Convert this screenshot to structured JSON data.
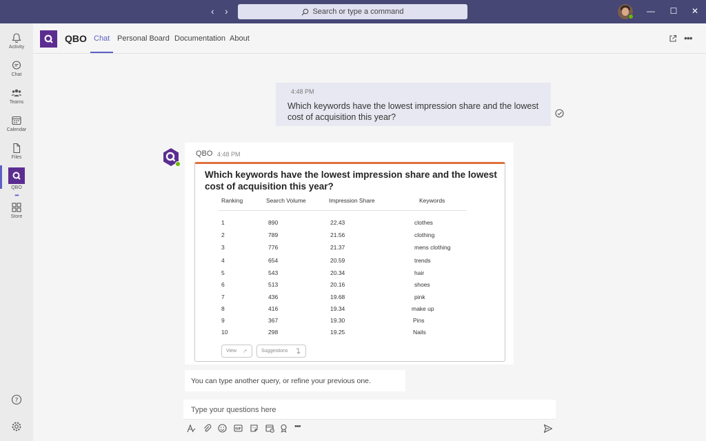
{
  "titlebar": {
    "search_placeholder": "Search or type a command",
    "back_icon": "‹",
    "forward_icon": "›",
    "minimize": "—",
    "maximize": "☐",
    "close": "✕"
  },
  "rail": {
    "items": [
      {
        "label": "Activity",
        "icon": "bell-icon"
      },
      {
        "label": "Chat",
        "icon": "chat-icon"
      },
      {
        "label": "Teams",
        "icon": "teams-icon"
      },
      {
        "label": "Calendar",
        "icon": "calendar-icon"
      },
      {
        "label": "Files",
        "icon": "file-icon"
      },
      {
        "label": "QBO",
        "icon": "qbo-logo"
      },
      {
        "label": "Store",
        "icon": "store-icon"
      }
    ],
    "more": "•••"
  },
  "header": {
    "app_name": "QBO",
    "tabs": [
      "Chat",
      "Personal Board",
      "Documentation",
      "About"
    ],
    "active_tab": "Chat"
  },
  "user_message": {
    "time": "4:48 PM",
    "text": "Which keywords have the lowest impression share and the lowest cost of acquisition this year?"
  },
  "bot_message": {
    "name": "QBO",
    "time": "4:48 PM",
    "card_title": "Which keywords have the lowest impression share and the lowest cost of acquisition this year?",
    "columns": [
      "Ranking",
      "Search Volume",
      "Impression Share",
      "Keywords"
    ],
    "rows": [
      [
        "1",
        "890",
        "22.43",
        "clothes"
      ],
      [
        "2",
        "789",
        "21.56",
        "clothing"
      ],
      [
        "3",
        "776",
        "21.37",
        "mens clothing"
      ],
      [
        "4",
        "654",
        "20.59",
        "trends"
      ],
      [
        "5",
        "543",
        "20.34",
        "hair"
      ],
      [
        "6",
        "513",
        "20.16",
        "shoes"
      ],
      [
        "7",
        "436",
        "19.68",
        "pink"
      ],
      [
        "8",
        "416",
        "19.34",
        "make up"
      ],
      [
        "9",
        "367",
        "19.30",
        "Pins"
      ],
      [
        "10",
        "298",
        "19.25",
        "Nails"
      ]
    ],
    "buttons": {
      "view": "View",
      "suggestions": "Suggestions"
    }
  },
  "hint": "You can type another query, or refine your previous one.",
  "compose": {
    "placeholder": "Type your questions here"
  },
  "colors": {
    "titlebar": "#464775",
    "accent": "#5b5fc7",
    "brand": "#5c2d91",
    "card_top": "#e0703d",
    "presence": "#6bb700"
  }
}
